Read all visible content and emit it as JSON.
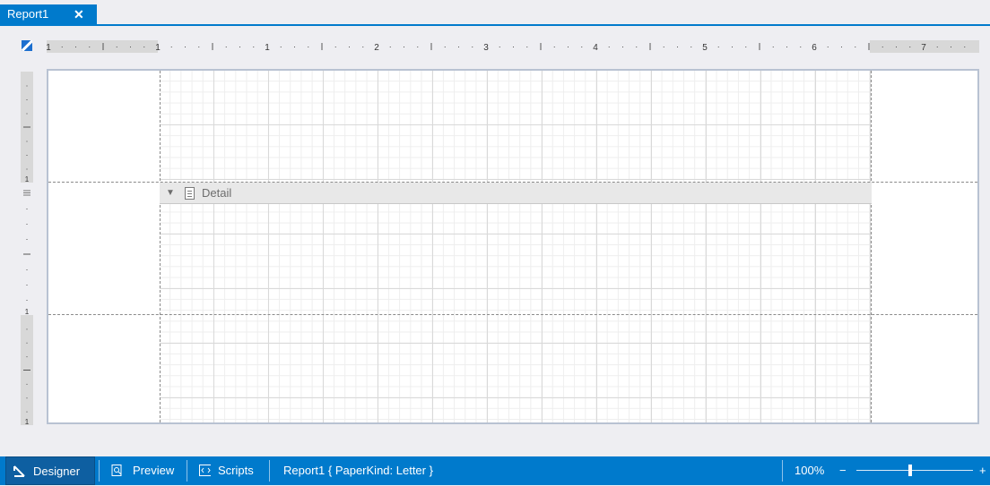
{
  "tab": {
    "title": "Report1",
    "close_glyph": "✕"
  },
  "ruler": {
    "horizontal_labels": [
      "1",
      "1",
      "2",
      "3",
      "4",
      "5",
      "6",
      "7"
    ],
    "vertical_labels": [
      "1",
      "1",
      "1"
    ]
  },
  "band": {
    "label": "Detail",
    "collapse_glyph": "▼",
    "icon": "band-icon"
  },
  "statusbar": {
    "designer_label": "Designer",
    "preview_label": "Preview",
    "scripts_label": "Scripts",
    "report_info": "Report1 { PaperKind: Letter }",
    "zoom_text": "100%",
    "zoom_out_glyph": "−",
    "zoom_in_glyph": "+",
    "zoom_level": 1.0
  },
  "colors": {
    "accent": "#007acc",
    "active_button": "#0e5fa1"
  }
}
